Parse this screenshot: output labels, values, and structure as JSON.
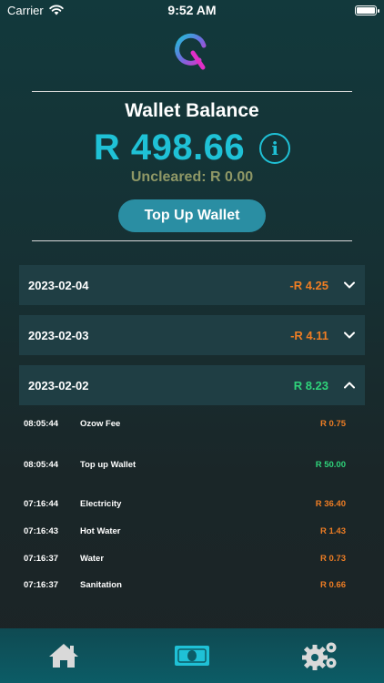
{
  "status_bar": {
    "carrier": "Carrier",
    "time": "9:52 AM"
  },
  "wallet": {
    "title": "Wallet Balance",
    "balance": "R 498.66",
    "info_symbol": "i",
    "uncleared": "Uncleared: R 0.00",
    "top_up_label": "Top Up Wallet"
  },
  "days": [
    {
      "date": "2023-02-04",
      "amount": "-R 4.25",
      "expanded": false
    },
    {
      "date": "2023-02-03",
      "amount": "-R 4.11",
      "expanded": false
    },
    {
      "date": "2023-02-02",
      "amount": "R 8.23",
      "expanded": true
    }
  ],
  "transactions": [
    {
      "time": "08:05:44",
      "description": "Ozow Fee",
      "amount": "R 0.75"
    },
    {
      "time": "08:05:44",
      "description": "Top up Wallet",
      "amount": "R 50.00"
    },
    {
      "time": "07:16:44",
      "description": "Electricity",
      "amount": "R 36.40"
    },
    {
      "time": "07:16:43",
      "description": "Hot Water",
      "amount": "R 1.43"
    },
    {
      "time": "07:16:37",
      "description": "Water",
      "amount": "R 0.73"
    },
    {
      "time": "07:16:37",
      "description": "Sanitation",
      "amount": "R 0.66"
    }
  ],
  "tabs": [
    {
      "icon": "home-icon"
    },
    {
      "icon": "money-icon"
    },
    {
      "icon": "settings-gears-icon"
    }
  ],
  "colors": {
    "accent": "#1fc1d6",
    "negative": "#ee7d24",
    "positive": "#2fd37a",
    "uncleared": "#8f9866",
    "button": "#2a8ea3"
  }
}
